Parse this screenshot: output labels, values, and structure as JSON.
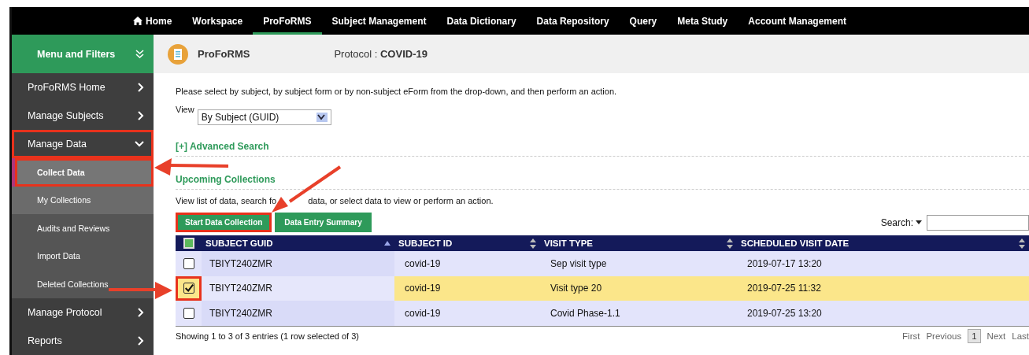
{
  "nav": [
    {
      "label": "Home",
      "kind": "home",
      "selected": false
    },
    {
      "label": "Workspace",
      "kind": "link",
      "selected": false
    },
    {
      "label": "ProFoRMS",
      "kind": "link",
      "selected": true
    },
    {
      "label": "Subject Management",
      "kind": "link",
      "selected": false
    },
    {
      "label": "Data Dictionary",
      "kind": "link",
      "selected": false
    },
    {
      "label": "Data Repository",
      "kind": "link",
      "selected": false
    },
    {
      "label": "Query",
      "kind": "link",
      "selected": false
    },
    {
      "label": "Meta Study",
      "kind": "link",
      "selected": false
    },
    {
      "label": "Account Management",
      "kind": "link",
      "selected": false
    }
  ],
  "sidebar": {
    "title": "Menu and Filters",
    "items": [
      {
        "label": "ProFoRMS Home",
        "expanded": false,
        "highlighted": false
      },
      {
        "label": "Manage Subjects",
        "expanded": false,
        "highlighted": false
      },
      {
        "label": "Manage Data",
        "expanded": true,
        "highlighted": true,
        "children": [
          {
            "label": "Collect Data",
            "selected": true,
            "highlighted": true
          },
          {
            "label": "My Collections",
            "selected": false,
            "highlighted": false
          },
          {
            "label": "Audits and Reviews",
            "selected": false,
            "highlighted": false
          },
          {
            "label": "Import Data",
            "selected": false,
            "highlighted": false
          },
          {
            "label": "Deleted Collections",
            "selected": false,
            "highlighted": false
          }
        ]
      },
      {
        "label": "Manage Protocol",
        "expanded": false,
        "highlighted": false
      },
      {
        "label": "Reports",
        "expanded": false,
        "highlighted": false
      }
    ]
  },
  "header": {
    "title": "ProFoRMS",
    "protocol": "Protocol : **COVID-19**"
  },
  "intro": "Please select by subject, by subject form or by non-subject eForm from the drop-down, and then perform an action.",
  "view": {
    "label": "View",
    "value": "By Subject (GUID)"
  },
  "advanced_search": "[+] Advanced Search",
  "section_title": "Upcoming Collections",
  "section_text": [
    "View list of data, search fo",
    "data, or select data to view or perform an action."
  ],
  "buttons": [
    {
      "label": "Start Data Collection",
      "highlighted": true
    },
    {
      "label": "Data Entry Summary",
      "highlighted": false
    }
  ],
  "search": {
    "label": "Search:"
  },
  "table": {
    "select_all": {
      "indeterminate": true
    },
    "columns": [
      {
        "label": "SUBJECT GUID",
        "sorted": true
      },
      {
        "label": "SUBJECT ID",
        "sorted": false
      },
      {
        "label": "VISIT TYPE",
        "sorted": false
      },
      {
        "label": "SCHEDULED VISIT DATE",
        "sorted": false
      }
    ],
    "rows": [
      {
        "cells": [
          "TBIYT240ZMR",
          "covid-19",
          "Sep visit type",
          "2019-07-17 13:20"
        ],
        "selected": false,
        "checked": false,
        "highlighted": false
      },
      {
        "cells": [
          "TBIYT240ZMR",
          "covid-19",
          "Visit type 20",
          "2019-07-25 11:32"
        ],
        "selected": true,
        "checked": true,
        "highlighted": true
      },
      {
        "cells": [
          "TBIYT240ZMR",
          "covid-19",
          "Covid Phase-1.1",
          "2019-07-25 13:20"
        ],
        "selected": false,
        "checked": false,
        "highlighted": false
      }
    ]
  },
  "info": "Showing 1 to 3 of 3 entries (1 row selected of 3)",
  "pagination": [
    {
      "label": "First",
      "kind": "link",
      "selected": false
    },
    {
      "label": "Previous",
      "kind": "link",
      "selected": false
    },
    {
      "label": "1",
      "kind": "page",
      "selected": true
    },
    {
      "label": "Next",
      "kind": "link",
      "selected": false
    },
    {
      "label": "Last",
      "kind": "link",
      "selected": false
    }
  ]
}
